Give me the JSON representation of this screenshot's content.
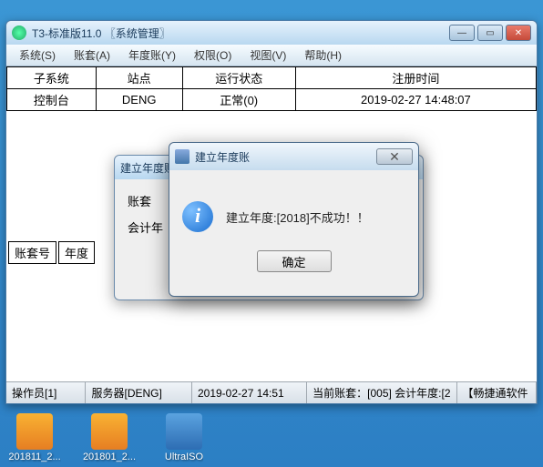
{
  "mainWindow": {
    "title": "T3-标准版11.0 〖系统管理〗",
    "menu": [
      "系统(S)",
      "账套(A)",
      "年度账(Y)",
      "权限(O)",
      "视图(V)",
      "帮助(H)"
    ],
    "table": {
      "headers": [
        "子系统",
        "站点",
        "运行状态",
        "注册时间"
      ],
      "row": [
        "控制台",
        "DENG",
        "正常(0)",
        "2019-02-27 14:48:07"
      ]
    },
    "lowerHeaders": [
      "账套号",
      "年度"
    ],
    "status": {
      "operator": "操作员[1]",
      "server": "服务器[DENG]",
      "time": "2019-02-27 14:51",
      "account": "当前账套：[005] 会计年度:[2",
      "vendor": "【畅捷通软件"
    }
  },
  "dialog1": {
    "title": "建立年度账",
    "labels": {
      "account": "账套",
      "year": "会计年"
    }
  },
  "dialog2": {
    "title": "建立年度账",
    "message": "建立年度:[2018]不成功！！",
    "ok": "确定"
  },
  "desktop": {
    "icon1": "201811_2...",
    "icon2": "201801_2...",
    "icon3": "UltraISO"
  }
}
